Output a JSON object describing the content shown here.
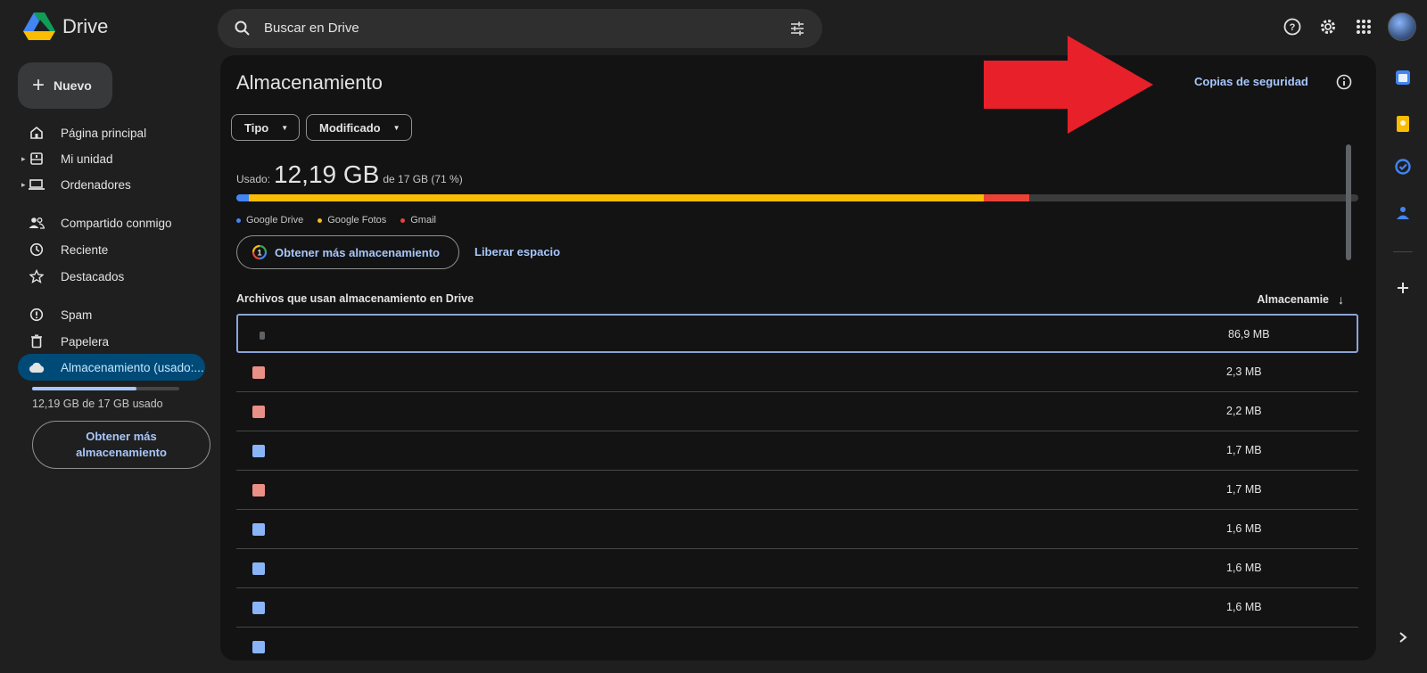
{
  "app": {
    "name": "Drive"
  },
  "search": {
    "placeholder": "Buscar en Drive"
  },
  "sidebar": {
    "new_label": "Nuevo",
    "items": [
      {
        "label": "Página principal",
        "icon": "home-icon"
      },
      {
        "label": "Mi unidad",
        "icon": "my-drive-icon"
      },
      {
        "label": "Ordenadores",
        "icon": "computers-icon"
      },
      {
        "label": "Compartido conmigo",
        "icon": "shared-icon"
      },
      {
        "label": "Reciente",
        "icon": "recent-icon"
      },
      {
        "label": "Destacados",
        "icon": "star-icon"
      },
      {
        "label": "Spam",
        "icon": "spam-icon"
      },
      {
        "label": "Papelera",
        "icon": "trash-icon"
      },
      {
        "label": "Almacenamiento (usado:...",
        "icon": "cloud-icon"
      }
    ],
    "storage_fraction": 0.71,
    "storage_text": "12,19 GB de 17 GB usado",
    "get_more": "Obtener más almacenamiento"
  },
  "main": {
    "title": "Almacenamiento",
    "backup_link": "Copias de seguridad",
    "filters": {
      "type": "Tipo",
      "modified": "Modificado"
    },
    "used_label": "Usado:",
    "used_value": "12,19 GB",
    "used_of": "de 17 GB (71 %)",
    "quota": {
      "drive_fraction": 0.011,
      "photos_fraction": 0.655,
      "gmail_fraction": 0.041
    },
    "legend": [
      "Google Drive",
      "Google Fotos",
      "Gmail"
    ],
    "get_more": "Obtener más almacenamiento",
    "free_space": "Liberar espacio",
    "files_header": "Archivos que usan almacenamiento en Drive",
    "storage_column": "Almacenamie",
    "files": [
      {
        "type": "other",
        "size": "86,9 MB"
      },
      {
        "type": "pdf",
        "size": "2,3 MB"
      },
      {
        "type": "pdf",
        "size": "2,2 MB"
      },
      {
        "type": "doc",
        "size": "1,7 MB"
      },
      {
        "type": "pdf",
        "size": "1,7 MB"
      },
      {
        "type": "doc",
        "size": "1,6 MB"
      },
      {
        "type": "doc",
        "size": "1,6 MB"
      },
      {
        "type": "doc",
        "size": "1,6 MB"
      },
      {
        "type": "doc",
        "size": ""
      }
    ]
  },
  "colors": {
    "drive": "#4285f4",
    "photos": "#fbbc04",
    "gmail": "#ea4335",
    "annotation_arrow": "#e8202a"
  }
}
